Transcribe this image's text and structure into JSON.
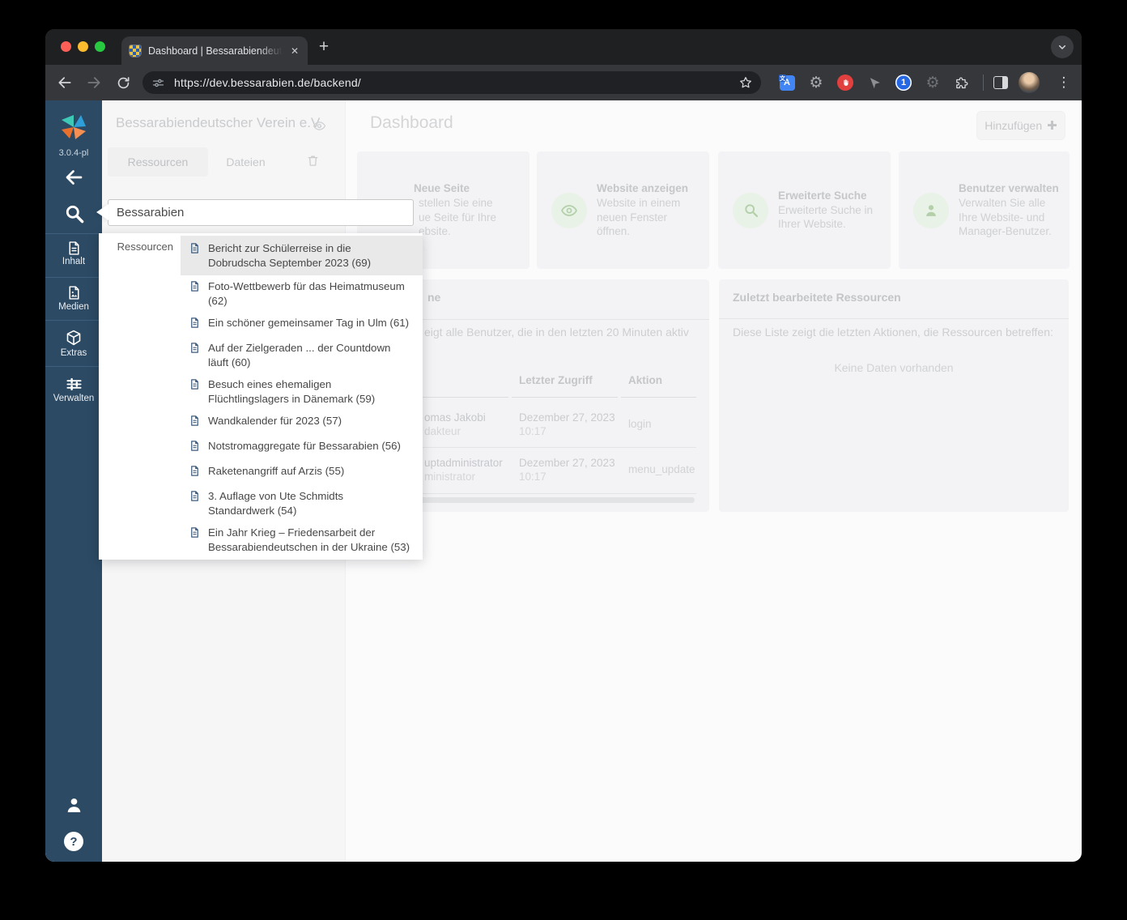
{
  "browser": {
    "tab_title": "Dashboard | Bessarabiendeut",
    "url": "https://dev.bessarabien.de/backend/"
  },
  "app_sidebar": {
    "version": "3.0.4-pl",
    "items": [
      {
        "label": "Inhalt",
        "icon": "document-icon"
      },
      {
        "label": "Medien",
        "icon": "media-icon"
      },
      {
        "label": "Extras",
        "icon": "cube-icon"
      },
      {
        "label": "Verwalten",
        "icon": "sliders-icon"
      }
    ]
  },
  "search": {
    "value": "Bessarabien",
    "group_label": "Ressourcen",
    "selected_index": 0,
    "results": [
      "Bericht zur Schülerreise in die Dobrudscha September 2023 (69)",
      "Foto-Wettbewerb für das Heimatmuseum (62)",
      "Ein schöner gemeinsamer Tag in Ulm (61)",
      "Auf der Zielgeraden ... der Countdown läuft (60)",
      "Besuch eines ehemaligen Flüchtlingslagers in Dänemark (59)",
      "Wandkalender für 2023 (57)",
      "Notstromaggregate für Bessarabien (56)",
      "Raketenangriff auf Arzis (55)",
      "3. Auflage von Ute Schmidts Standardwerk (54)",
      "Ein Jahr Krieg – Friedensarbeit der Bessarabiendeutschen in der Ukraine (53)"
    ]
  },
  "site_panel": {
    "title": "Bessarabiendeutscher Verein e.V.",
    "tabs": [
      "Ressourcen",
      "Dateien"
    ]
  },
  "main": {
    "title": "Dashboard",
    "add_button": "Hinzufügen",
    "cards": [
      {
        "title": "Neue Seite",
        "lines": [
          "stellen Sie eine",
          "ue Seite für Ihre",
          "ebsite."
        ]
      },
      {
        "title": "Website anzeigen",
        "body": "Website in einem neuen Fenster öffnen.",
        "icon": "eye-icon"
      },
      {
        "title": "Erweiterte Suche",
        "body": "Erweiterte Suche in Ihrer Website.",
        "icon": "search-icon"
      },
      {
        "title": "Benutzer verwalten",
        "body": "Verwalten Sie alle Ihre Website- und Manager-Benutzer.",
        "icon": "user-icon"
      }
    ],
    "users_panel": {
      "title_fragment": "ne",
      "description_fragment": "eigt alle Benutzer, die in den letzten 20 Minuten aktiv",
      "columns": [
        "Letzter Zugriff",
        "Aktion"
      ],
      "rows": [
        {
          "name_fragment": "omas Jakobi",
          "role_fragment": "dakteur",
          "date": "Dezember 27, 2023",
          "time": "10:17",
          "action": "login"
        },
        {
          "name_fragment": "uptadministrator",
          "role_fragment": "ministrator",
          "date": "Dezember 27, 2023",
          "time": "10:17",
          "action": "menu_update"
        }
      ]
    },
    "resources_panel": {
      "title": "Zuletzt bearbeitete Ressourcen",
      "description": "Diese Liste zeigt die letzten Aktionen, die Ressourcen betreffen:",
      "empty": "Keine Daten vorhanden"
    }
  },
  "colors": {
    "sidebar_blue": "#2c4a64",
    "accent_green_bg": "#e9f2e6",
    "accent_green": "#b3d0aa",
    "selected_result_bg": "#e9e9e9",
    "traffic_lights": [
      "#ff5f57",
      "#febc2e",
      "#28c840"
    ]
  },
  "icons": {
    "search": "magnifier",
    "back": "left-arrow",
    "help": "question-circle",
    "user": "person-silhouette",
    "trash": "trash-can",
    "eye": "eye-outline",
    "results": "document-page"
  }
}
